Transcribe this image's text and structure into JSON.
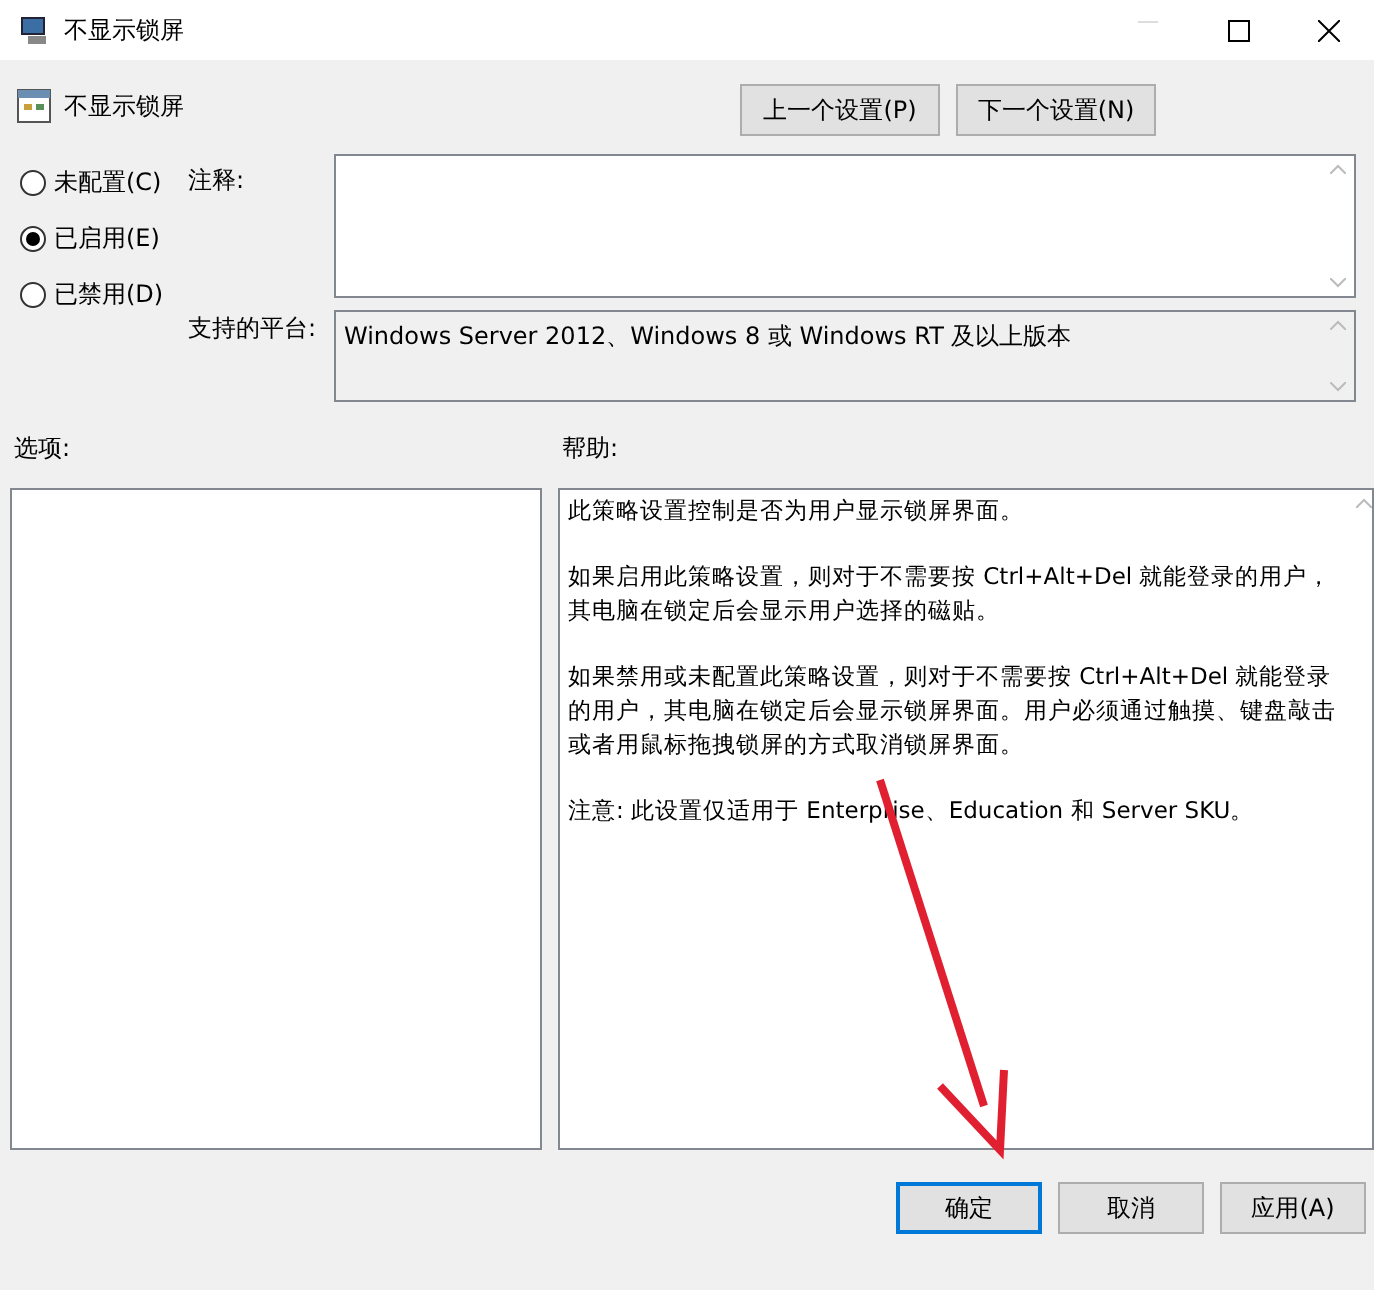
{
  "window": {
    "title": "不显示锁屏"
  },
  "header": {
    "title": "不显示锁屏",
    "buttons": [
      "上一个设置(P)",
      "下一个设置(N)"
    ]
  },
  "state_options": [
    {
      "label": "未配置(C)",
      "selected": false
    },
    {
      "label": "已启用(E)",
      "selected": true
    },
    {
      "label": "已禁用(D)",
      "selected": false
    }
  ],
  "comment": {
    "label": "注释:"
  },
  "platform": {
    "label": "支持的平台:",
    "value": "Windows Server 2012、Windows 8 或 Windows RT 及以上版本"
  },
  "options": {
    "label": "选项:"
  },
  "help": {
    "label": "帮助:",
    "paragraphs": [
      "此策略设置控制是否为用户显示锁屏界面。",
      "如果启用此策略设置，则对于不需要按 Ctrl+Alt+Del 就能登录的用户，其电脑在锁定后会显示用户选择的磁贴。",
      "如果禁用或未配置此策略设置，则对于不需要按 Ctrl+Alt+Del 就能登录的用户，其电脑在锁定后会显示锁屏界面。用户必须通过触摸、键盘敲击或者用鼠标拖拽锁屏的方式取消锁屏界面。",
      "注意: 此设置仅适用于 Enterprise、Education 和 Server SKU。"
    ]
  },
  "footer_buttons": [
    {
      "label": "确定",
      "selected": true
    },
    {
      "label": "取消",
      "selected": false
    },
    {
      "label": "应用(A)",
      "selected": false
    }
  ]
}
